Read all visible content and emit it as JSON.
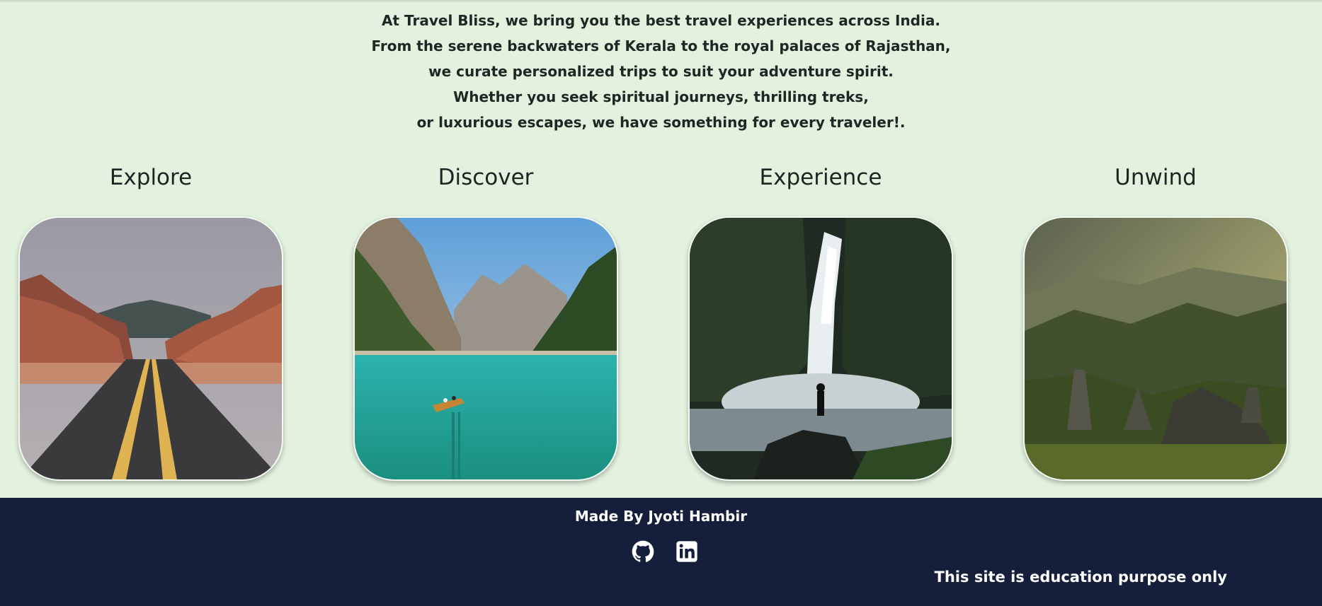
{
  "intro": {
    "lines": [
      "At Travel Bliss, we bring you the best travel experiences across India.",
      "From the serene backwaters of Kerala to the royal palaces of Rajasthan,",
      "we curate personalized trips to suit your adventure spirit.",
      "Whether you seek spiritual journeys, thrilling treks,",
      "or luxurious escapes, we have something for every traveler!."
    ]
  },
  "cards": [
    {
      "title": "Explore",
      "image": "desert-road-canyon-photo"
    },
    {
      "title": "Discover",
      "image": "mountain-lake-boat-photo"
    },
    {
      "title": "Experience",
      "image": "waterfall-hiker-photo"
    },
    {
      "title": "Unwind",
      "image": "misty-green-mountains-photo"
    }
  ],
  "footer": {
    "credit": "Made By Jyoti Hambir",
    "icons": [
      "github-icon",
      "linkedin-icon"
    ],
    "notice": "This site is education purpose only"
  },
  "colors": {
    "page_background": "#e3f2df",
    "footer_background": "#151f3b",
    "text": "#1f2623"
  }
}
